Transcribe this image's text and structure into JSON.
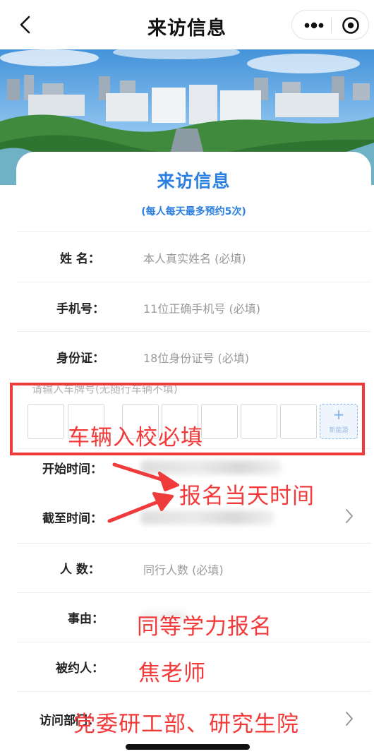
{
  "nav": {
    "title": "来访信息"
  },
  "card": {
    "title": "来访信息",
    "subtitle": "(每人每天最多预约5次)"
  },
  "form": {
    "name": {
      "label": "姓  名：",
      "placeholder": "本人真实姓名 (必填)"
    },
    "phone": {
      "label": "手机号：",
      "placeholder": "11位正确手机号 (必填)"
    },
    "id_card": {
      "label": "身份证：",
      "placeholder": "18位身份证号 (必填)"
    },
    "plate": {
      "hint": "请输入车牌号(无随行车辆不填)",
      "new_energy_plus": "+",
      "new_energy_label": "新能源"
    },
    "start_time": {
      "label": "开始时间："
    },
    "end_time": {
      "label": "截至时间："
    },
    "people": {
      "label": "人  数：",
      "placeholder": "同行人数 (必填)"
    },
    "reason": {
      "label": "事由："
    },
    "invitee": {
      "label": "被约人："
    },
    "department": {
      "label": "访问部门："
    }
  },
  "annotations": {
    "plate_note": "车辆入校必填",
    "time_note": "报名当天时间",
    "reason_note": "同等学力报名",
    "invitee_note": "焦老师",
    "department_note": "党委研工部、研究生院"
  },
  "colors": {
    "accent": "#2b7fe0",
    "annotation": "#ef3b3b"
  }
}
